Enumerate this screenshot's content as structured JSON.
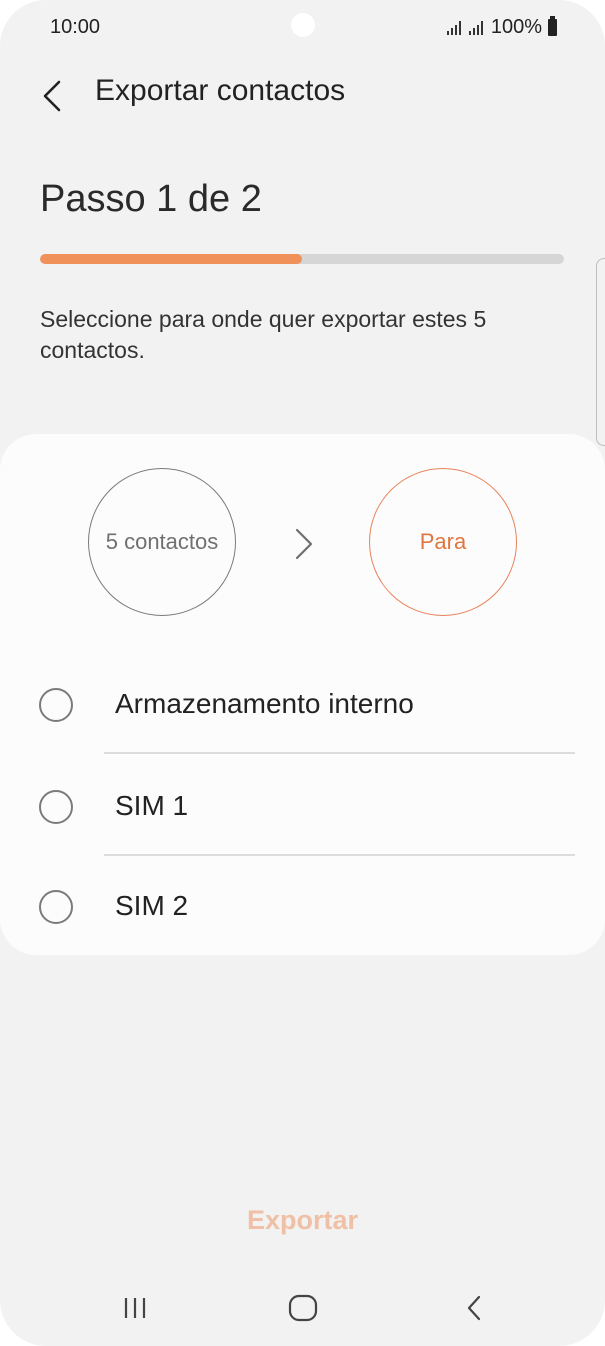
{
  "status_bar": {
    "time": "10:00",
    "battery": "100%"
  },
  "header": {
    "title": "Exportar contactos"
  },
  "step": {
    "title": "Passo 1 de 2",
    "progress_fraction": 0.5
  },
  "description": "Seleccione para onde quer exportar estes 5 contactos.",
  "flow": {
    "source_label": "5 contactos",
    "destination_label": "Para"
  },
  "options": [
    {
      "label": "Armazenamento interno",
      "selected": false
    },
    {
      "label": "SIM 1",
      "selected": false
    },
    {
      "label": "SIM 2",
      "selected": false
    }
  ],
  "export_button": {
    "label": "Exportar",
    "enabled": false
  },
  "colors": {
    "accent": "#f0915a",
    "accent_text": "#e0763f",
    "disabled_button": "#efc0a5",
    "background": "#f2f2f2",
    "card": "#fcfcfc"
  },
  "icons": {
    "back": "chevron-left-icon",
    "flow_arrow": "chevron-right-icon",
    "nav_recents": "recents-icon",
    "nav_home": "home-icon",
    "nav_back": "back-icon"
  }
}
